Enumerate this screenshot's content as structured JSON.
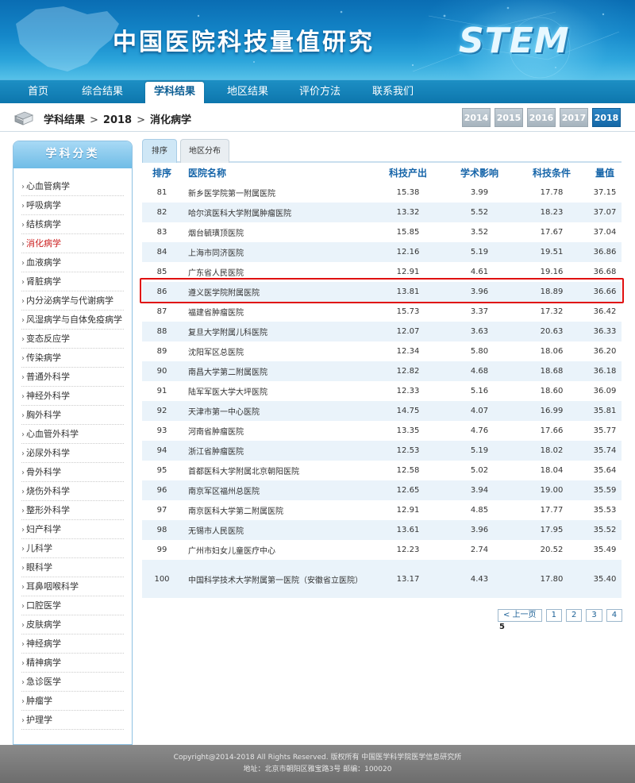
{
  "header": {
    "title": "中国医院科技量值研究",
    "logo": "STEM"
  },
  "nav": {
    "items": [
      {
        "label": "首页"
      },
      {
        "label": "综合结果"
      },
      {
        "label": "学科结果"
      },
      {
        "label": "地区结果"
      },
      {
        "label": "评价方法"
      },
      {
        "label": "联系我们"
      }
    ],
    "active": "学科结果"
  },
  "breadcrumb": {
    "level1": "学科结果",
    "sep": ">",
    "level2": "2018",
    "level3": "消化病学"
  },
  "years": [
    "2014",
    "2015",
    "2016",
    "2017",
    "2018"
  ],
  "active_year": "2018",
  "sidebar": {
    "title": "学科分类",
    "bullet": "›",
    "items": [
      "心血管病学",
      "呼吸病学",
      "结核病学",
      "消化病学",
      "血液病学",
      "肾脏病学",
      "内分泌病学与代谢病学",
      "风湿病学与自体免疫病学",
      "变态反应学",
      "传染病学",
      "普通外科学",
      "神经外科学",
      "胸外科学",
      "心血管外科学",
      "泌尿外科学",
      "骨外科学",
      "烧伤外科学",
      "整形外科学",
      "妇产科学",
      "儿科学",
      "眼科学",
      "耳鼻咽喉科学",
      "口腔医学",
      "皮肤病学",
      "神经病学",
      "精神病学",
      "急诊医学",
      "肿瘤学",
      "护理学"
    ],
    "active": "消化病学"
  },
  "tabs": [
    {
      "label": "排序"
    },
    {
      "label": "地区分布"
    }
  ],
  "table": {
    "headers": [
      "排序",
      "医院名称",
      "科技产出",
      "学术影响",
      "科技条件",
      "量值"
    ],
    "rows": [
      [
        "81",
        "新乡医学院第一附属医院",
        "15.38",
        "3.99",
        "17.78",
        "37.15"
      ],
      [
        "82",
        "哈尔滨医科大学附属肿瘤医院",
        "13.32",
        "5.52",
        "18.23",
        "37.07"
      ],
      [
        "83",
        "烟台毓璜顶医院",
        "15.85",
        "3.52",
        "17.67",
        "37.04"
      ],
      [
        "84",
        "上海市同济医院",
        "12.16",
        "5.19",
        "19.51",
        "36.86"
      ],
      [
        "85",
        "广东省人民医院",
        "12.91",
        "4.61",
        "19.16",
        "36.68"
      ],
      [
        "86",
        "遵义医学院附属医院",
        "13.81",
        "3.96",
        "18.89",
        "36.66"
      ],
      [
        "87",
        "福建省肿瘤医院",
        "15.73",
        "3.37",
        "17.32",
        "36.42"
      ],
      [
        "88",
        "复旦大学附属儿科医院",
        "12.07",
        "3.63",
        "20.63",
        "36.33"
      ],
      [
        "89",
        "沈阳军区总医院",
        "12.34",
        "5.80",
        "18.06",
        "36.20"
      ],
      [
        "90",
        "南昌大学第二附属医院",
        "12.82",
        "4.68",
        "18.68",
        "36.18"
      ],
      [
        "91",
        "陆军军医大学大坪医院",
        "12.33",
        "5.16",
        "18.60",
        "36.09"
      ],
      [
        "92",
        "天津市第一中心医院",
        "14.75",
        "4.07",
        "16.99",
        "35.81"
      ],
      [
        "93",
        "河南省肿瘤医院",
        "13.35",
        "4.76",
        "17.66",
        "35.77"
      ],
      [
        "94",
        "浙江省肿瘤医院",
        "12.53",
        "5.19",
        "18.02",
        "35.74"
      ],
      [
        "95",
        "首都医科大学附属北京朝阳医院",
        "12.58",
        "5.02",
        "18.04",
        "35.64"
      ],
      [
        "96",
        "南京军区福州总医院",
        "12.65",
        "3.94",
        "19.00",
        "35.59"
      ],
      [
        "97",
        "南京医科大学第二附属医院",
        "12.91",
        "4.85",
        "17.77",
        "35.53"
      ],
      [
        "98",
        "无锡市人民医院",
        "13.61",
        "3.96",
        "17.95",
        "35.52"
      ],
      [
        "99",
        "广州市妇女儿童医疗中心",
        "12.23",
        "2.74",
        "20.52",
        "35.49"
      ],
      [
        "100",
        "中国科学技术大学附属第一医院（安徽省立医院）",
        "13.17",
        "4.43",
        "17.80",
        "35.40"
      ]
    ]
  },
  "pagination": {
    "prev": "< 上一页",
    "pages": [
      "1",
      "2",
      "3",
      "4"
    ],
    "current": "5"
  },
  "footer": {
    "line1": "Copyright@2014-2018 All Rights Reserved. 版权所有 中国医学科学院医学信息研究所",
    "line2": "地址：北京市朝阳区雅宝路3号 邮编：100020"
  }
}
